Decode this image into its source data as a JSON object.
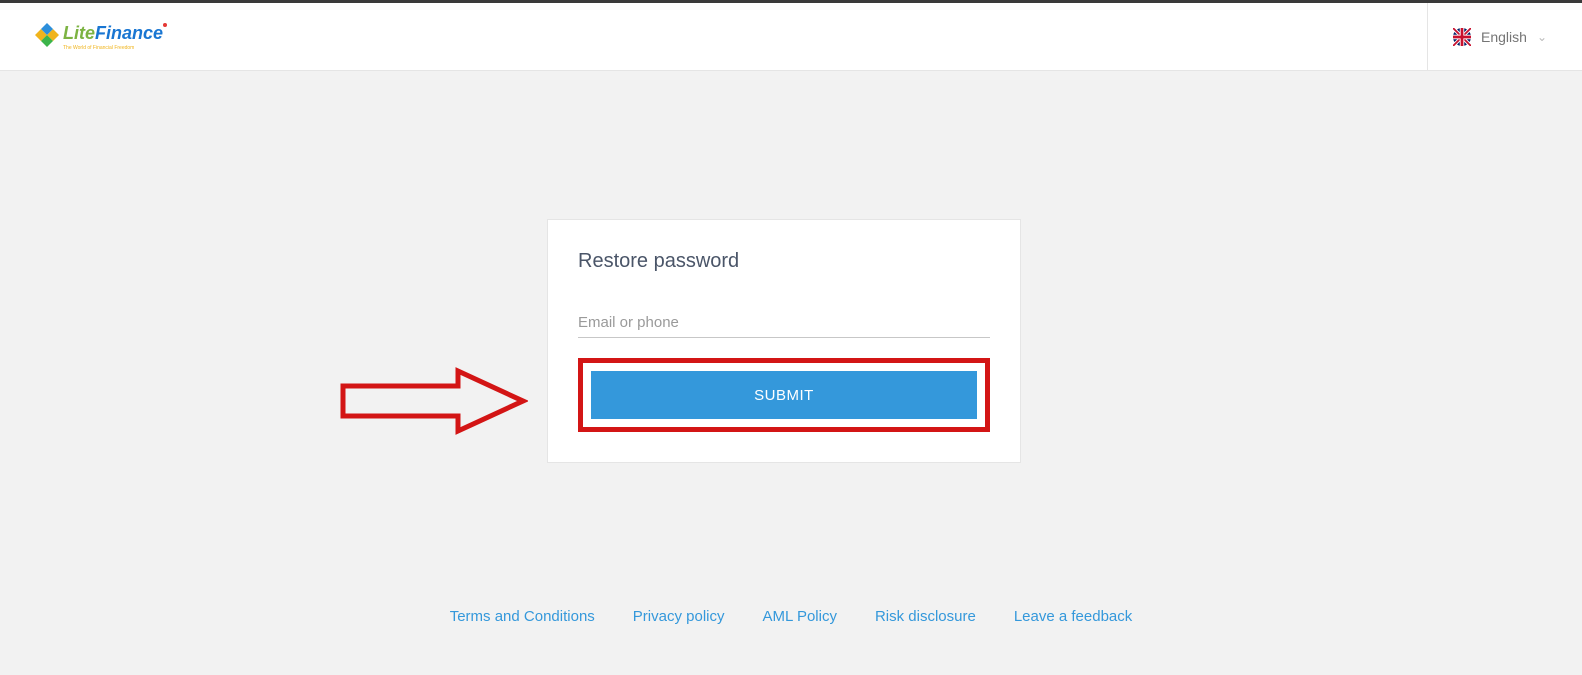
{
  "header": {
    "logo": {
      "text_lite": "Lite",
      "text_finance": "Finance",
      "tagline": "The World of Financial Freedom"
    },
    "language": {
      "label": "English"
    }
  },
  "card": {
    "title": "Restore password",
    "input_placeholder": "Email or phone",
    "submit_label": "SUBMIT"
  },
  "footer": {
    "links": [
      "Terms and Conditions",
      "Privacy policy",
      "AML Policy",
      "Risk disclosure",
      "Leave a feedback"
    ]
  }
}
